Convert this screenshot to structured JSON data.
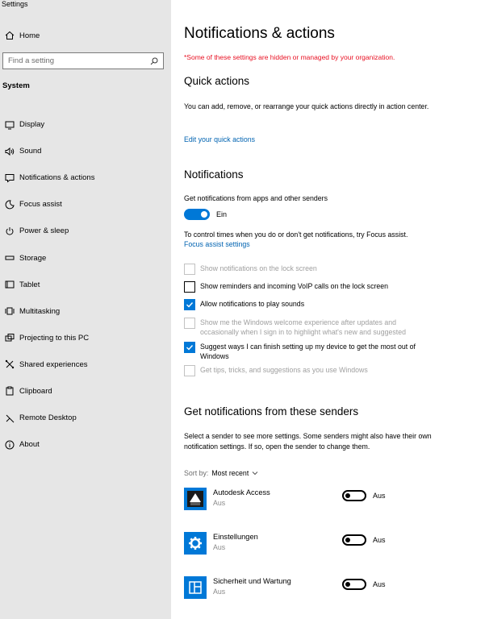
{
  "app_title": "Settings",
  "sidebar": {
    "home_label": "Home",
    "search_placeholder": "Find a setting",
    "section_label": "System",
    "items": [
      {
        "label": "Display",
        "icon": "display-icon"
      },
      {
        "label": "Sound",
        "icon": "sound-icon"
      },
      {
        "label": "Notifications & actions",
        "icon": "notifications-icon"
      },
      {
        "label": "Focus assist",
        "icon": "moon-icon"
      },
      {
        "label": "Power & sleep",
        "icon": "power-icon"
      },
      {
        "label": "Storage",
        "icon": "storage-icon"
      },
      {
        "label": "Tablet",
        "icon": "tablet-icon"
      },
      {
        "label": "Multitasking",
        "icon": "multitasking-icon"
      },
      {
        "label": "Projecting to this PC",
        "icon": "projecting-icon"
      },
      {
        "label": "Shared experiences",
        "icon": "shared-icon"
      },
      {
        "label": "Clipboard",
        "icon": "clipboard-icon"
      },
      {
        "label": "Remote Desktop",
        "icon": "remote-desktop-icon"
      },
      {
        "label": "About",
        "icon": "info-icon"
      }
    ]
  },
  "main": {
    "title": "Notifications & actions",
    "warning": "*Some of these settings are hidden or managed by your organization.",
    "quick_actions": {
      "heading": "Quick actions",
      "description": "You can add, remove, or rearrange your quick actions directly in action center.",
      "link": "Edit your quick actions"
    },
    "notifications": {
      "heading": "Notifications",
      "get_label": "Get notifications from apps and other senders",
      "toggle_state": "Ein",
      "focus_text": "To control times when you do or don't get notifications, try Focus assist.",
      "focus_link": "Focus assist settings",
      "checkboxes": [
        {
          "label": "Show notifications on the lock screen",
          "checked": false,
          "disabled": true
        },
        {
          "label": "Show reminders and incoming VoIP calls on the lock screen",
          "checked": false,
          "disabled": false
        },
        {
          "label": "Allow notifications to play sounds",
          "checked": true,
          "disabled": false
        },
        {
          "label": "Show me the Windows welcome experience after updates and occasionally when I sign in to highlight what's new and suggested",
          "checked": false,
          "disabled": true
        },
        {
          "label": "Suggest ways I can finish setting up my device to get the most out of Windows",
          "checked": true,
          "disabled": false
        },
        {
          "label": "Get tips, tricks, and suggestions as you use Windows",
          "checked": false,
          "disabled": true
        }
      ]
    },
    "senders": {
      "heading": "Get notifications from these senders",
      "description": "Select a sender to see more settings. Some senders might also have their own notification settings. If so, open the sender to change them.",
      "sort_label": "Sort by:",
      "sort_value": "Most recent",
      "items": [
        {
          "name": "Autodesk Access",
          "status": "Aus",
          "toggle": "Aus",
          "icon": "autodesk-access-icon"
        },
        {
          "name": "Einstellungen",
          "status": "Aus",
          "toggle": "Aus",
          "icon": "gear-icon"
        },
        {
          "name": "Sicherheit und Wartung",
          "status": "Aus",
          "toggle": "Aus",
          "icon": "security-maintenance-icon"
        }
      ]
    }
  },
  "colors": {
    "accent": "#0078d7",
    "link": "#0063b1",
    "warning": "#e81123",
    "sidebar_bg": "#e6e6e6"
  }
}
